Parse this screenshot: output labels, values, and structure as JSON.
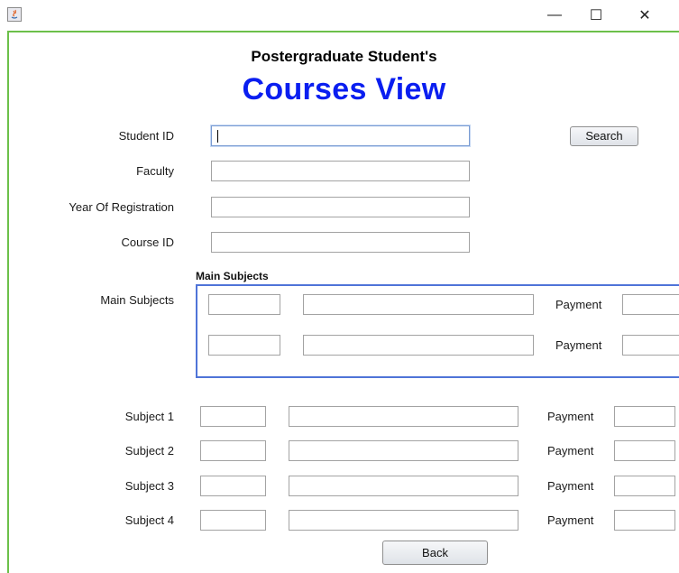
{
  "window": {
    "min_symbol": "—",
    "max_symbol": "☐",
    "close_symbol": "✕"
  },
  "heading": {
    "subtitle": "Postergraduate Student's",
    "title": "Courses View"
  },
  "form": {
    "student_id_label": "Student ID",
    "faculty_label": "Faculty",
    "year_label": "Year Of Registration",
    "course_id_label": "Course ID",
    "student_id_value": "",
    "faculty_value": "",
    "year_value": "",
    "course_id_value": ""
  },
  "search_button": "Search",
  "main_subjects": {
    "label": "Main Subjects",
    "group_title": "Main Subjects",
    "rows": [
      {
        "payment_label": "Payment"
      },
      {
        "payment_label": "Payment"
      }
    ]
  },
  "subjects": [
    {
      "label": "Subject 1",
      "payment_label": "Payment"
    },
    {
      "label": "Subject 2",
      "payment_label": "Payment"
    },
    {
      "label": "Subject 3",
      "payment_label": "Payment"
    },
    {
      "label": "Subject 4",
      "payment_label": "Payment"
    }
  ],
  "back_button": "Back",
  "colors": {
    "title_blue": "#0a1ef0",
    "frame_green": "#6cc04a",
    "group_border_blue": "#4f74d8"
  }
}
